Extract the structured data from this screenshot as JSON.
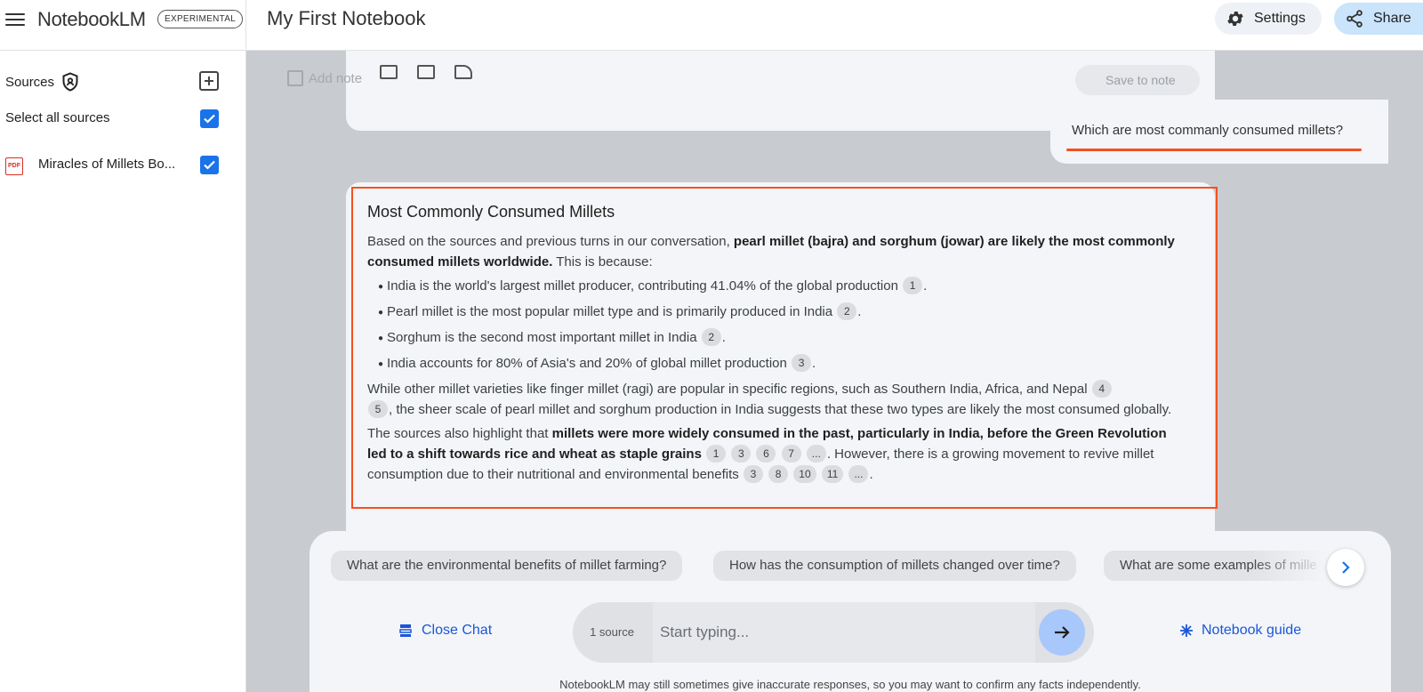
{
  "header": {
    "logo": "NotebookLM",
    "badge": "EXPERIMENTAL",
    "notebook_title": "My First Notebook",
    "settings_label": "Settings",
    "share_label": "Share"
  },
  "sidebar": {
    "sources_label": "Sources",
    "select_all_label": "Select all sources",
    "source_item": "Miracles of Millets Bo...",
    "pdf_badge": "PDF"
  },
  "notes": {
    "add_note_label": "Add note",
    "save_to_note_label": "Save to note"
  },
  "chat": {
    "user_question": "Which are most commanly consumed millets?",
    "answer": {
      "title": "Most Commonly Consumed Millets",
      "p1_start": "Based on the sources and previous turns in our conversation, ",
      "p1_bold": "pearl millet (bajra) and sorghum (jowar) are likely the most commonly consumed millets worldwide.",
      "p1_end": " This is because:",
      "bullets": [
        {
          "text": "India is the world's largest millet producer, contributing 41.04% of the global production",
          "cite": "1"
        },
        {
          "text": "Pearl millet is the most popular millet type and is primarily produced in India",
          "cite": "2"
        },
        {
          "text": "Sorghum is the second most important millet in India",
          "cite": "2"
        },
        {
          "text": "India accounts for 80% of Asia's and 20% of global millet production",
          "cite": "3"
        }
      ],
      "p2_start": "While other millet varieties like finger millet (ragi) are popular in specific regions, such as Southern India, Africa, and Nepal",
      "p2_cites": [
        "4",
        "5"
      ],
      "p2_end": ", the sheer scale of pearl millet and sorghum production in India suggests that these two types are likely the most consumed globally.",
      "p3_start": "The sources also highlight that ",
      "p3_bold": "millets were more widely consumed in the past, particularly in India, before the Green Revolution led to a shift towards rice and wheat as staple grains",
      "p3_cites": [
        "1",
        "3",
        "6",
        "7",
        "..."
      ],
      "p3_mid": ". However, there is a growing movement to revive millet consumption due to their nutritional and environmental benefits",
      "p3_cites2": [
        "3",
        "8",
        "10",
        "11",
        "..."
      ],
      "p3_end": "."
    }
  },
  "suggestions": [
    "What are the environmental benefits of millet farming?",
    "How has the consumption of millets changed over time?",
    "What are some examples of mille"
  ],
  "composer": {
    "close_chat_label": "Close Chat",
    "source_count": "1 source",
    "placeholder": "Start typing...",
    "notebook_guide_label": "Notebook guide",
    "disclaimer": "NotebookLM may still sometimes give inaccurate responses, so you may want to confirm any facts independently."
  },
  "colors": {
    "accent": "#1a73e8",
    "highlight": "#f4511e",
    "link": "#1a56db"
  }
}
